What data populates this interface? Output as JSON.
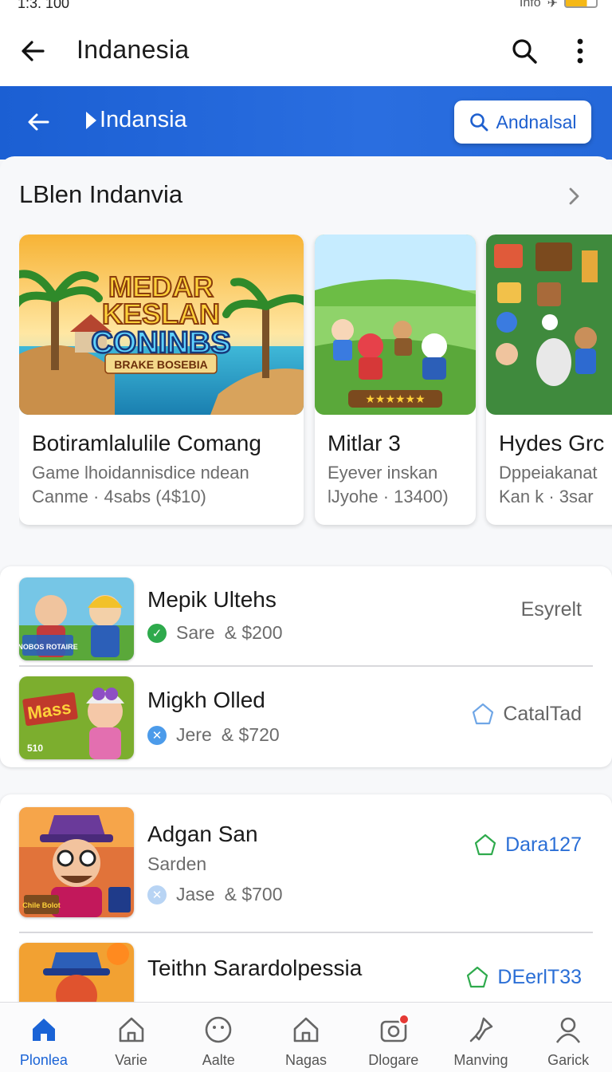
{
  "status_bar": {
    "time": "1:3. 100",
    "right_text": "Info"
  },
  "topbar": {
    "title": "Indanesia",
    "icons": [
      "back-arrow-icon",
      "search-icon",
      "more-vert-icon"
    ]
  },
  "banner": {
    "title": "Indansia",
    "button_label": "Andnalsal"
  },
  "section": {
    "title": "LBlen Indanvia"
  },
  "featured_cards": [
    {
      "image_title_lines": [
        "MEDAR",
        "KESLAN",
        "CONINBS"
      ],
      "image_subtitle": "BRAKE BOSEBIA",
      "title": "Botiramlalulile Comang",
      "line1": "Game lhoidannisdice ndean",
      "line2": "Canme · 4sabs  (4$10)"
    },
    {
      "title": "Mitlar 3",
      "line1": "Eyever inskan",
      "line2": "lJyohe · 13400)"
    },
    {
      "title": "Hydes Grc",
      "line1": "Dppeiakanat",
      "line2": "Kan k  · 3sar"
    }
  ],
  "list_group_1": [
    {
      "name": "Mepik Ultehs",
      "status": "Sare",
      "price": "& $200",
      "action": "Esyrelt",
      "thumb_text": "NOBOS ROTAIRE"
    },
    {
      "name": "Migkh Olled",
      "status": "Jere",
      "price": "& $720",
      "action": "CatalTad",
      "thumb_text": "Mass",
      "thumb_text2": "510"
    }
  ],
  "list_group_2": [
    {
      "name": "Adgan San",
      "sub": "Sarden",
      "status": "Jase",
      "price": "& $700",
      "action": "Dara127",
      "thumb_text": "Chile Bolot"
    },
    {
      "name": "Teithn Sarardolpessia",
      "action": "DEerlT33"
    }
  ],
  "bottom_nav": [
    {
      "label": "Plonlea",
      "icon": "home-icon",
      "active": true
    },
    {
      "label": "Varie",
      "icon": "house-outline-icon",
      "active": false
    },
    {
      "label": "Aalte",
      "icon": "smiley-icon",
      "active": false
    },
    {
      "label": "Nagas",
      "icon": "house-outline-icon",
      "active": false
    },
    {
      "label": "Dlogare",
      "icon": "camera-icon",
      "active": false
    },
    {
      "label": "Manving",
      "icon": "pin-icon",
      "active": false
    },
    {
      "label": "Garick",
      "icon": "person-icon",
      "active": false
    }
  ],
  "colors": {
    "primary_blue": "#1b5fd3",
    "accent_blue": "#1a63d6",
    "green": "#2eaa4c",
    "light_blue_badge": "#4c9bea"
  }
}
